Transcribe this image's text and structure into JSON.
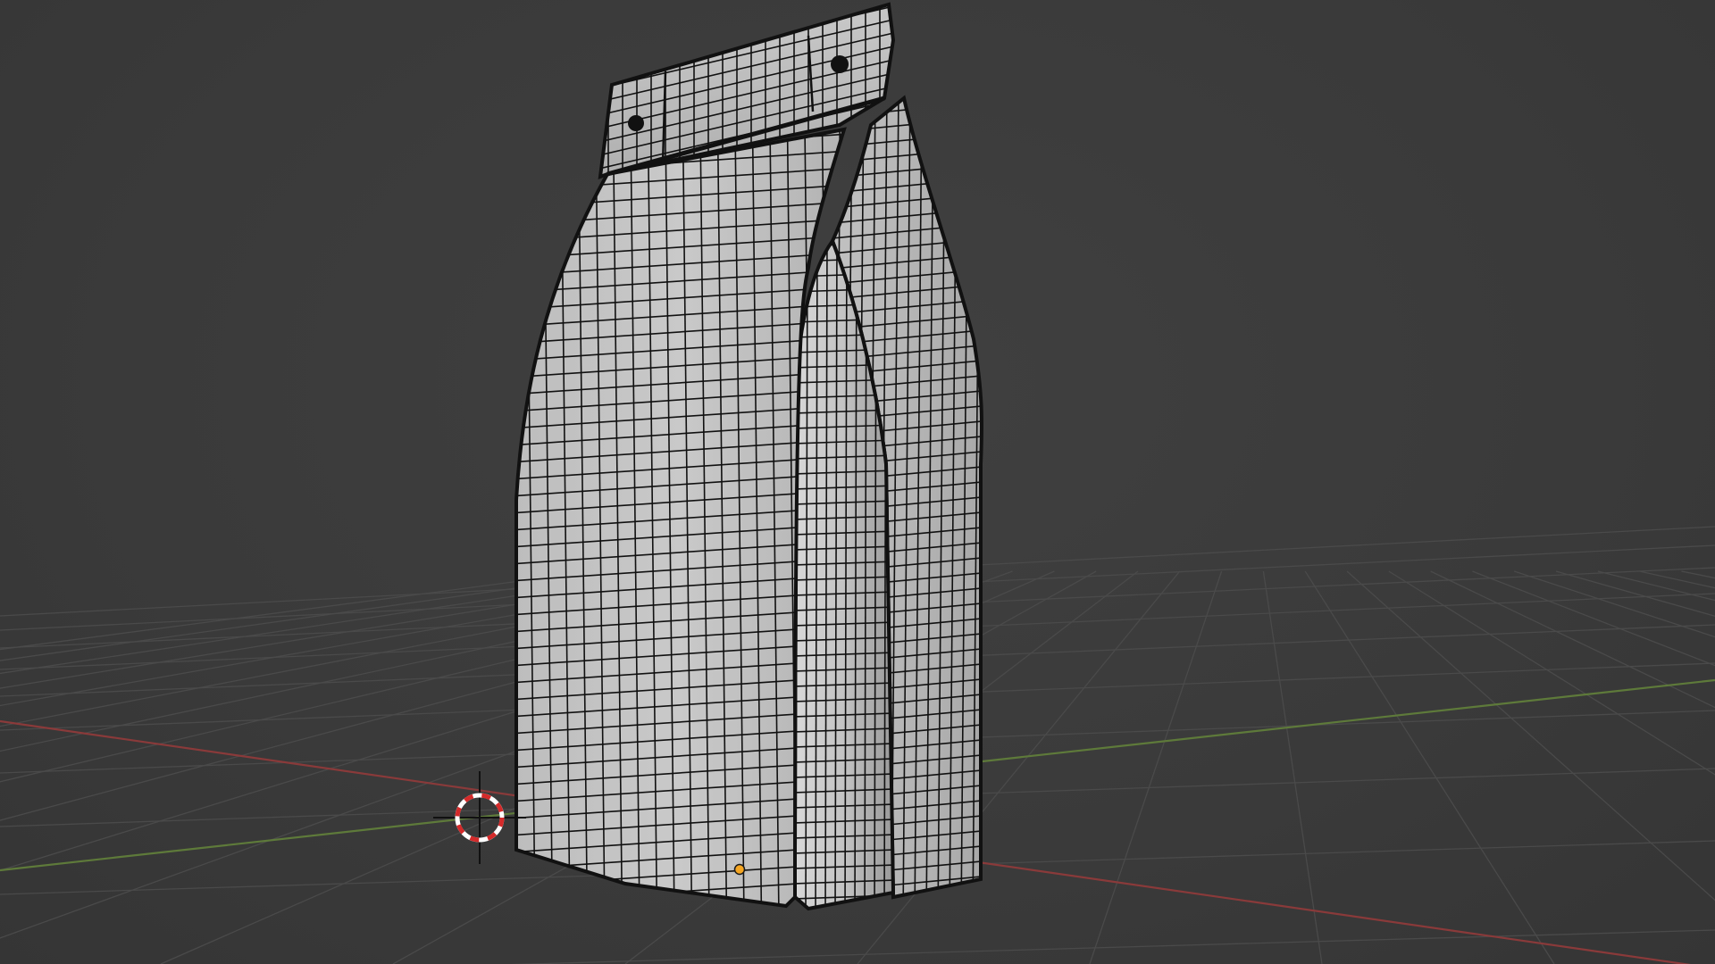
{
  "viewport": {
    "mode": "object-mode",
    "shading": "wireframe-overlay",
    "background_color": "#3d3d3d"
  },
  "colors": {
    "grid_line": "#4a4a4a",
    "x_axis": "#8a3a3a",
    "y_axis": "#5e7a3a",
    "mesh_fill": "#b9b9b9",
    "mesh_fill_light": "#d6d6d6",
    "mesh_fill_dark": "#8f8f8f",
    "wire": "#111111",
    "origin_dot": "#f5a623",
    "cursor_red": "#d42a2a",
    "cursor_white": "#ffffff"
  },
  "scene_object": {
    "kind": "mesh",
    "icon": "pouch-bag-mesh"
  },
  "cursor": {
    "icon": "3d-cursor-icon"
  }
}
